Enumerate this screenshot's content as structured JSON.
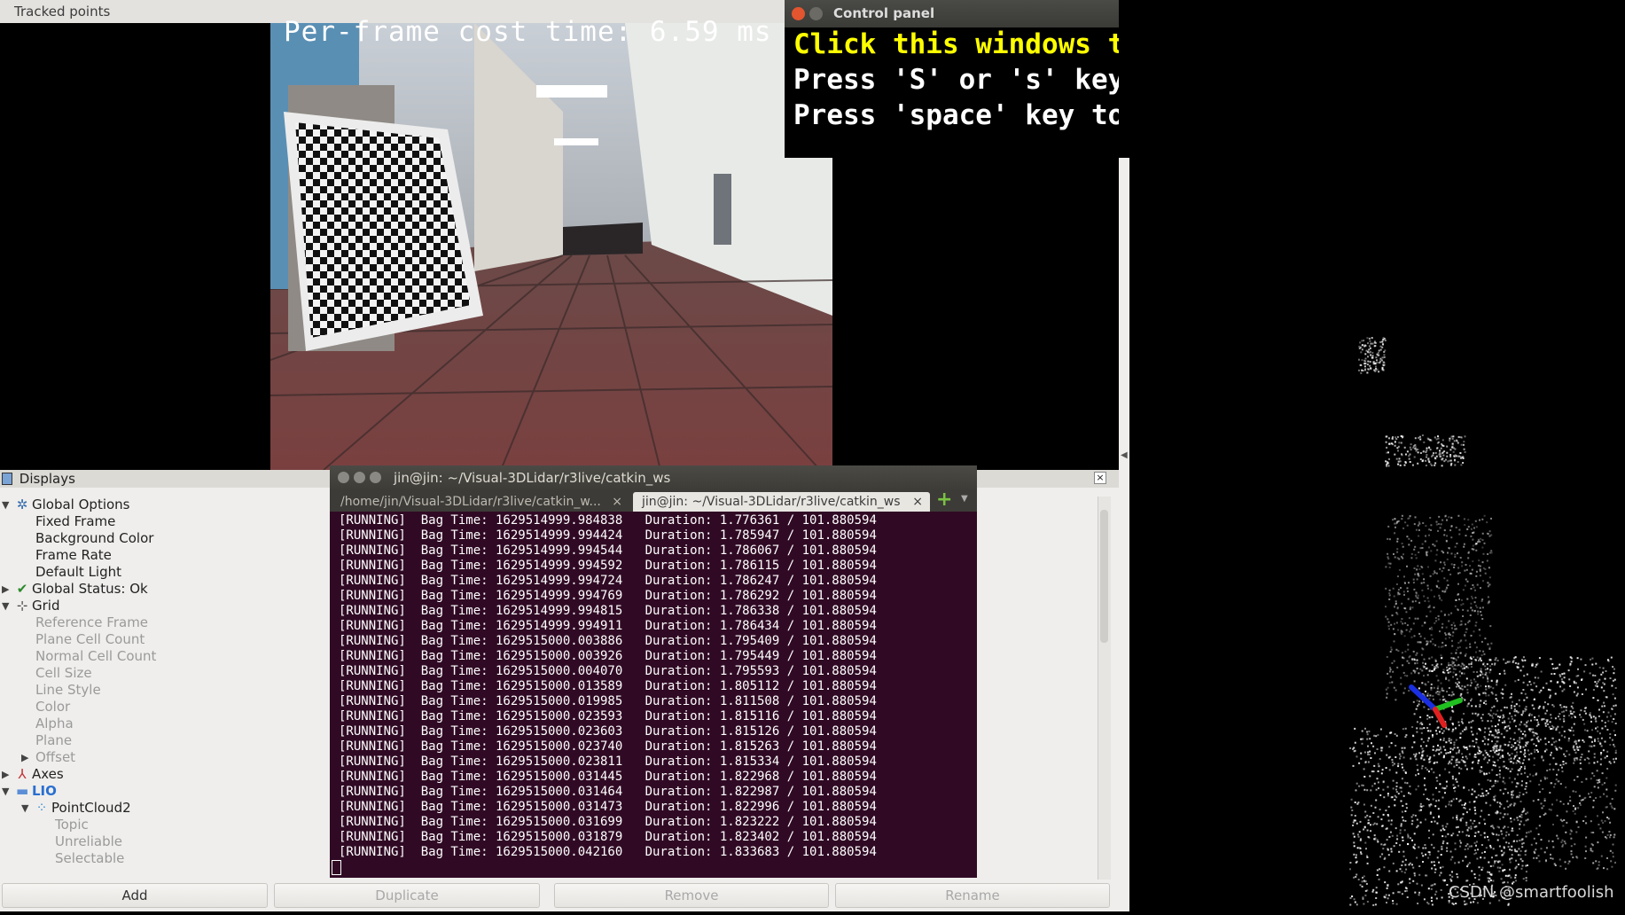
{
  "tracked_window": {
    "title": "Tracked points",
    "overlay_text": "Per-frame cost time: 6.59 ms"
  },
  "control_panel": {
    "title": "Control panel",
    "lines": [
      {
        "text": "Click this windows to enable the keyboard controls.",
        "color": "#ffff00"
      },
      {
        "text": "Press 'S' or 's' key to save current map",
        "color": "#ffffff"
      },
      {
        "text": "Press 'space' key to pause the mapping process",
        "color": "#ffffff"
      }
    ]
  },
  "displays": {
    "title": "Displays",
    "tree": [
      {
        "label": "Global Options",
        "depth": 0,
        "arrow": "open",
        "icon": "gear-icon",
        "dim": false
      },
      {
        "label": "Fixed Frame",
        "depth": 1,
        "dim": false
      },
      {
        "label": "Background Color",
        "depth": 1,
        "dim": false
      },
      {
        "label": "Frame Rate",
        "depth": 1,
        "dim": false
      },
      {
        "label": "Default Light",
        "depth": 1,
        "dim": false
      },
      {
        "label": "Global Status: Ok",
        "depth": 0,
        "arrow": "closed",
        "icon": "check-icon",
        "dim": false
      },
      {
        "label": "Grid",
        "depth": 0,
        "arrow": "open",
        "icon": "grid-icon",
        "dim": false
      },
      {
        "label": "Reference Frame",
        "depth": 1,
        "dim": true
      },
      {
        "label": "Plane Cell Count",
        "depth": 1,
        "dim": true
      },
      {
        "label": "Normal Cell Count",
        "depth": 1,
        "dim": true
      },
      {
        "label": "Cell Size",
        "depth": 1,
        "dim": true
      },
      {
        "label": "Line Style",
        "depth": 1,
        "dim": true
      },
      {
        "label": "Color",
        "depth": 1,
        "dim": true
      },
      {
        "label": "Alpha",
        "depth": 1,
        "dim": true
      },
      {
        "label": "Plane",
        "depth": 1,
        "dim": true
      },
      {
        "label": "Offset",
        "depth": 1,
        "arrow": "closed",
        "dim": true
      },
      {
        "label": "Axes",
        "depth": 0,
        "arrow": "closed",
        "icon": "axes-icon",
        "dim": false
      },
      {
        "label": "LIO",
        "depth": 0,
        "arrow": "open",
        "icon": "folder-icon",
        "dim": false,
        "highlight": true
      },
      {
        "label": "PointCloud2",
        "depth": 1,
        "arrow": "open",
        "icon": "pointcloud-icon",
        "dim": false
      },
      {
        "label": "Topic",
        "depth": 2,
        "dim": true
      },
      {
        "label": "Unreliable",
        "depth": 2,
        "dim": true
      },
      {
        "label": "Selectable",
        "depth": 2,
        "dim": true
      }
    ],
    "buttons": {
      "add": "Add",
      "duplicate": "Duplicate",
      "remove": "Remove",
      "rename": "Rename"
    }
  },
  "terminal": {
    "title": "jin@jin: ~/Visual-3DLidar/r3live/catkin_ws",
    "tabs": [
      {
        "label": "/home/jin/Visual-3DLidar/r3live/catkin_w...",
        "active": false
      },
      {
        "label": "jin@jin: ~/Visual-3DLidar/r3live/catkin_ws",
        "active": true
      }
    ],
    "lines": [
      "[RUNNING]  Bag Time: 1629514999.984838   Duration: 1.776361 / 101.880594",
      "[RUNNING]  Bag Time: 1629514999.994424   Duration: 1.785947 / 101.880594",
      "[RUNNING]  Bag Time: 1629514999.994544   Duration: 1.786067 / 101.880594",
      "[RUNNING]  Bag Time: 1629514999.994592   Duration: 1.786115 / 101.880594",
      "[RUNNING]  Bag Time: 1629514999.994724   Duration: 1.786247 / 101.880594",
      "[RUNNING]  Bag Time: 1629514999.994769   Duration: 1.786292 / 101.880594",
      "[RUNNING]  Bag Time: 1629514999.994815   Duration: 1.786338 / 101.880594",
      "[RUNNING]  Bag Time: 1629514999.994911   Duration: 1.786434 / 101.880594",
      "[RUNNING]  Bag Time: 1629515000.003886   Duration: 1.795409 / 101.880594",
      "[RUNNING]  Bag Time: 1629515000.003926   Duration: 1.795449 / 101.880594",
      "[RUNNING]  Bag Time: 1629515000.004070   Duration: 1.795593 / 101.880594",
      "[RUNNING]  Bag Time: 1629515000.013589   Duration: 1.805112 / 101.880594",
      "[RUNNING]  Bag Time: 1629515000.019985   Duration: 1.811508 / 101.880594",
      "[RUNNING]  Bag Time: 1629515000.023593   Duration: 1.815116 / 101.880594",
      "[RUNNING]  Bag Time: 1629515000.023603   Duration: 1.815126 / 101.880594",
      "[RUNNING]  Bag Time: 1629515000.023740   Duration: 1.815263 / 101.880594",
      "[RUNNING]  Bag Time: 1629515000.023811   Duration: 1.815334 / 101.880594",
      "[RUNNING]  Bag Time: 1629515000.031445   Duration: 1.822968 / 101.880594",
      "[RUNNING]  Bag Time: 1629515000.031464   Duration: 1.822987 / 101.880594",
      "[RUNNING]  Bag Time: 1629515000.031473   Duration: 1.822996 / 101.880594",
      "[RUNNING]  Bag Time: 1629515000.031699   Duration: 1.823222 / 101.880594",
      "[RUNNING]  Bag Time: 1629515000.031879   Duration: 1.823402 / 101.880594",
      "[RUNNING]  Bag Time: 1629515000.042160   Duration: 1.833683 / 101.880594"
    ]
  },
  "watermark": "CSDN @smartfoolish"
}
